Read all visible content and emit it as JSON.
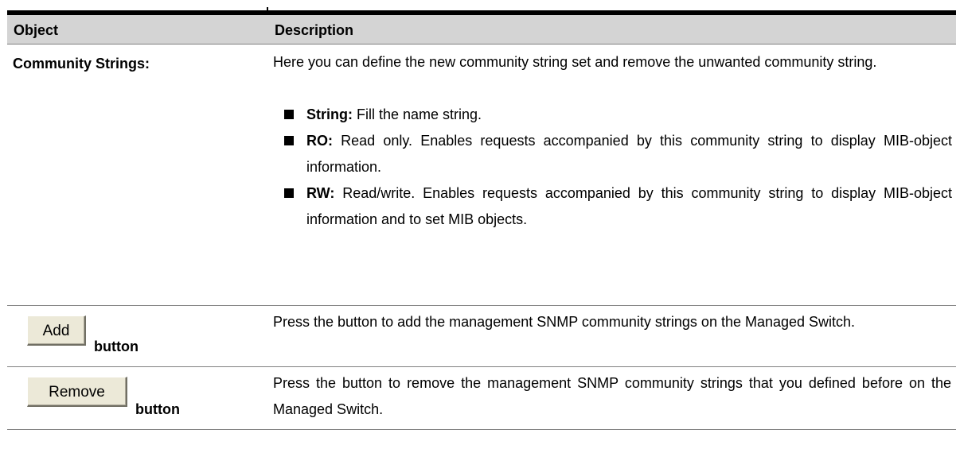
{
  "table": {
    "header": {
      "object": "Object",
      "description": "Description"
    },
    "community_row": {
      "object": "Community Strings:",
      "intro": "Here you can define the new community string set and remove the unwanted community string.",
      "bullets": [
        {
          "term": "String:",
          "text": " Fill the name string."
        },
        {
          "term": "RO:",
          "text": " Read only. Enables requests accompanied by this community string to display MIB-object information."
        },
        {
          "term": "RW:",
          "text": " Read/write. Enables requests accompanied by this community string to display MIB-object information and to set MIB objects."
        }
      ]
    },
    "add_row": {
      "button_label": "Add",
      "caption": "button",
      "description": "Press the button to add the management SNMP community strings on the Managed Switch."
    },
    "remove_row": {
      "button_label": "Remove",
      "caption": "button",
      "description": "Press the button to remove the management SNMP community strings that you defined before on the Managed Switch."
    }
  },
  "colors": {
    "header_background": "#d4d4d4",
    "rule": "#000000",
    "row_divider": "#808080",
    "button_face": "#ece9d8"
  }
}
